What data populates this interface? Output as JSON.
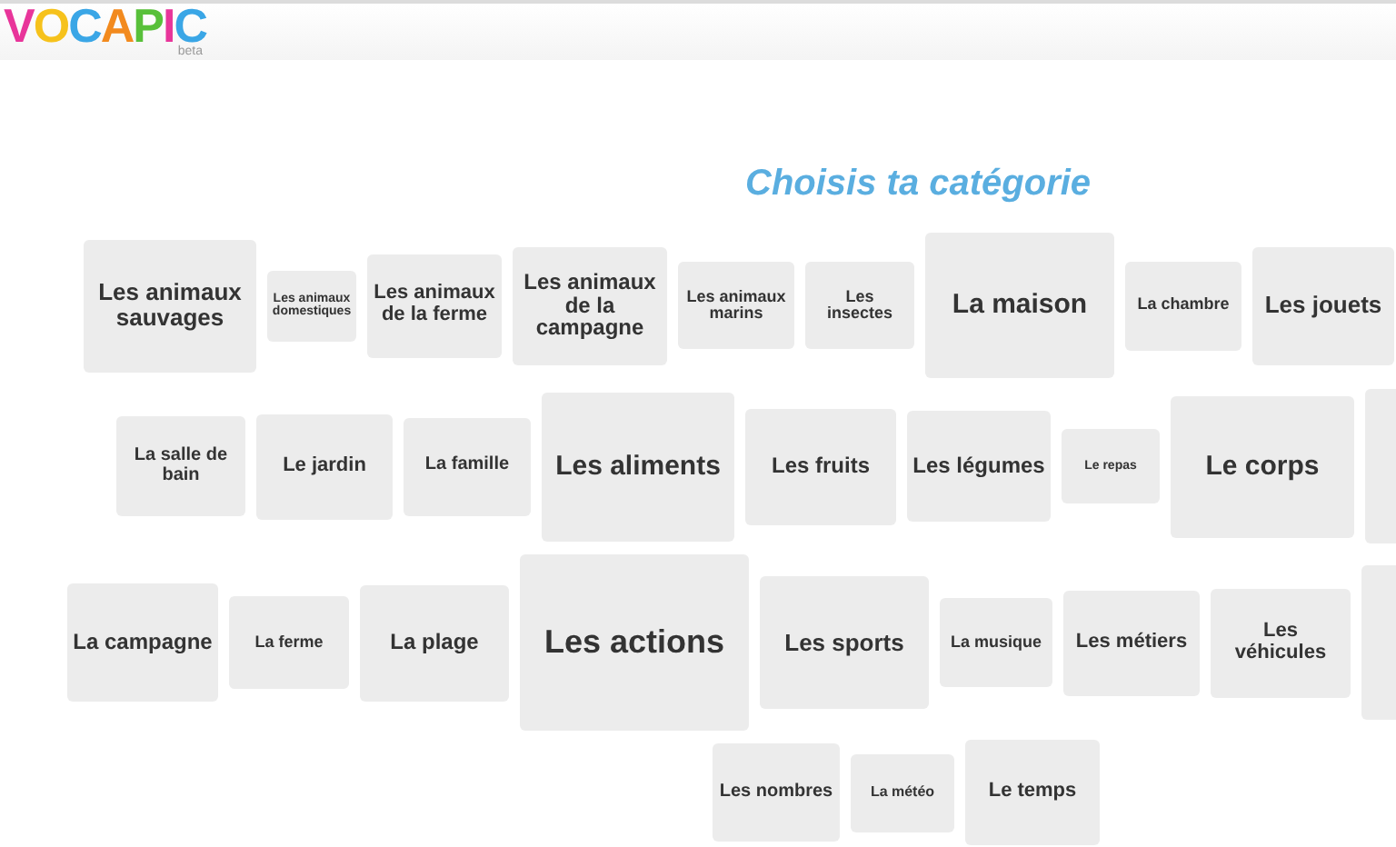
{
  "logo": {
    "text": "VOCAPIC",
    "badge": "beta"
  },
  "title": "Choisis ta catégorie",
  "rows": [
    {
      "tiles": [
        {
          "label": "Les animaux sauvages"
        },
        {
          "label": "Les animaux domestiques"
        },
        {
          "label": "Les animaux de la ferme"
        },
        {
          "label": "Les animaux de la campagne"
        },
        {
          "label": "Les animaux marins"
        },
        {
          "label": "Les insectes"
        },
        {
          "label": "La maison"
        },
        {
          "label": "La chambre"
        },
        {
          "label": "Les jouets"
        }
      ]
    },
    {
      "tiles": [
        {
          "label": "La salle de bain"
        },
        {
          "label": "Le jardin"
        },
        {
          "label": "La famille"
        },
        {
          "label": "Les aliments"
        },
        {
          "label": "Les fruits"
        },
        {
          "label": "Les légumes"
        },
        {
          "label": "Le repas"
        },
        {
          "label": "Le corps"
        }
      ]
    },
    {
      "tiles": [
        {
          "label": "La campagne"
        },
        {
          "label": "La ferme"
        },
        {
          "label": "La plage"
        },
        {
          "label": "Les actions"
        },
        {
          "label": "Les sports"
        },
        {
          "label": "La musique"
        },
        {
          "label": "Les métiers"
        },
        {
          "label": "Les véhicules"
        }
      ]
    },
    {
      "tiles": [
        {
          "label": "Les nombres"
        },
        {
          "label": "La météo"
        },
        {
          "label": "Le temps"
        }
      ]
    }
  ]
}
